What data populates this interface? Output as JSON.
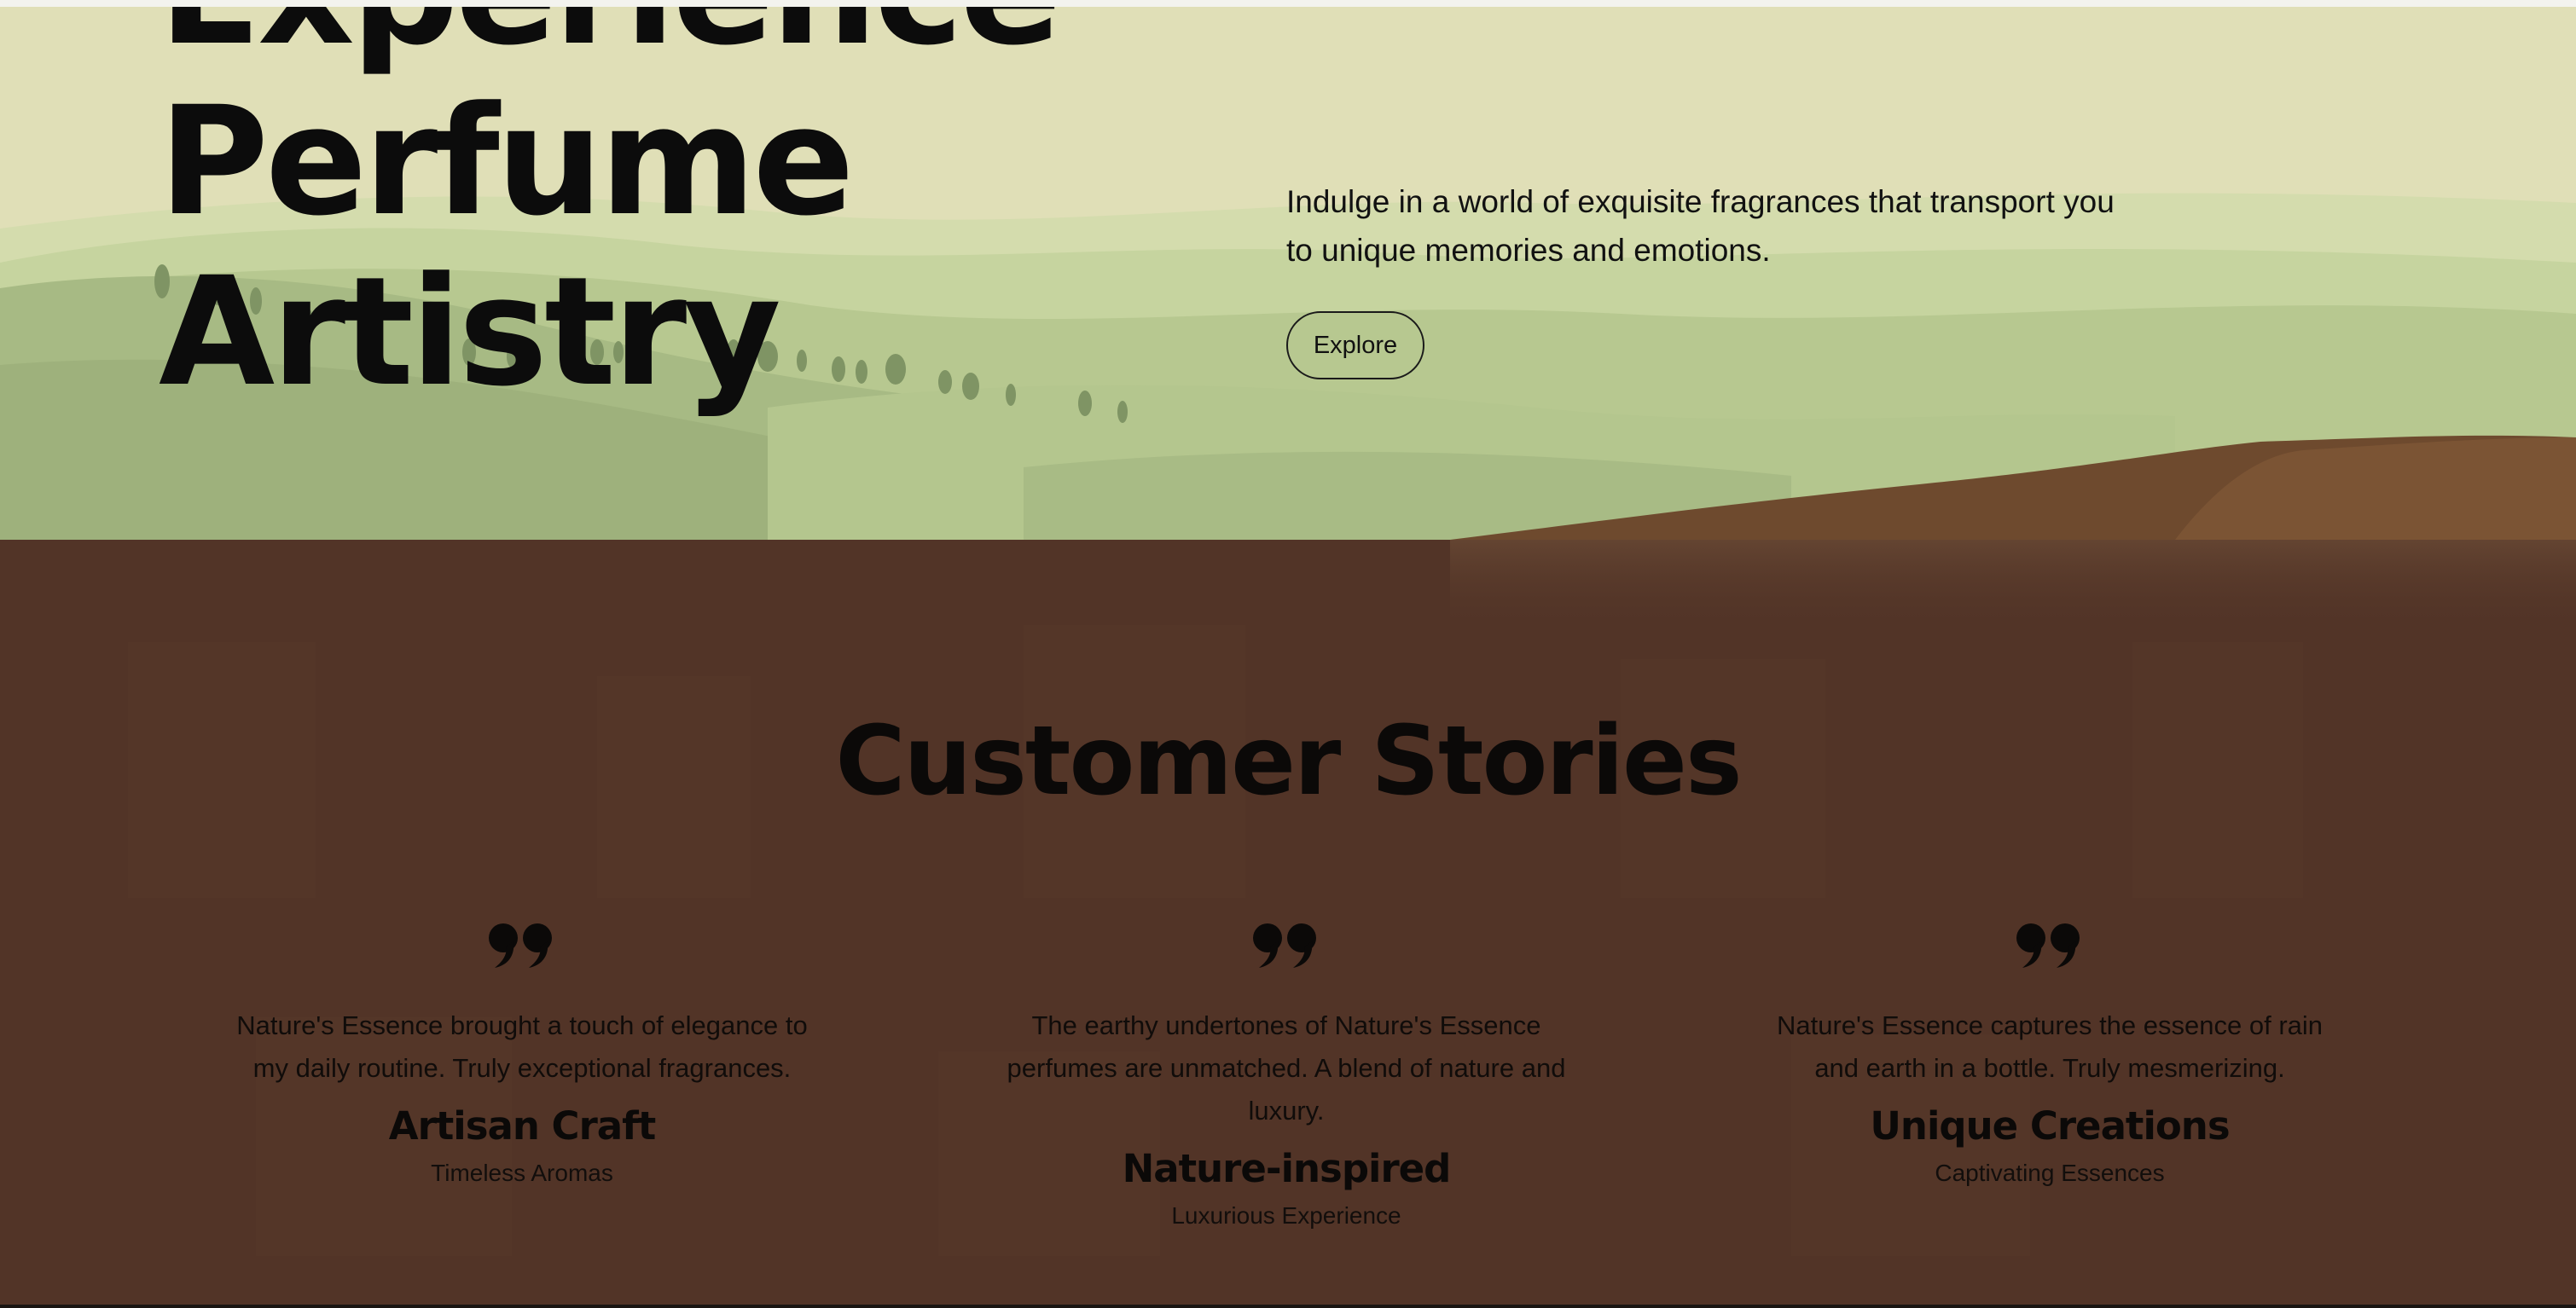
{
  "hero": {
    "title_line_1": "Experience",
    "title_line_2": "Perfume",
    "title_line_3": "Artistry",
    "description": "Indulge in a world of exquisite fragrances that transport you to unique memories and emotions.",
    "explore_label": "Explore"
  },
  "stories": {
    "heading": "Customer Stories",
    "cards": [
      {
        "quote": "Nature's Essence brought a touch of elegance to my daily routine. Truly exceptional fragrances.",
        "title": "Artisan Craft",
        "subtitle": "Timeless Aromas"
      },
      {
        "quote": "The earthy undertones of Nature's Essence perfumes are unmatched. A blend of nature and luxury.",
        "title": "Nature-inspired",
        "subtitle": "Luxurious Experience"
      },
      {
        "quote": "Nature's Essence captures the essence of rain and earth in a bottle. Truly mesmerizing.",
        "title": "Unique Creations",
        "subtitle": "Captivating Essences"
      }
    ]
  },
  "icons": {
    "quote": "quote-icon"
  },
  "colors": {
    "hero_sky": "#e0dfb7",
    "hills_light": "#c4d39f",
    "hills_mid": "#a9bd86",
    "earth": "#6b4a30",
    "stories_bg": "#523427",
    "text_dark": "#0c0c0c"
  }
}
